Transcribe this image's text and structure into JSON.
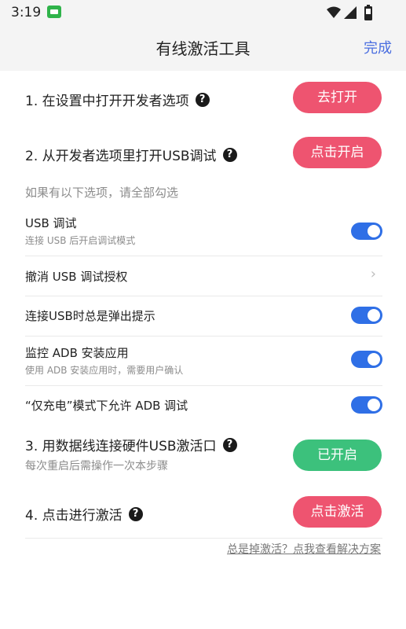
{
  "status_bar": {
    "time": "3:19"
  },
  "header": {
    "title": "有线激活工具",
    "done_label": "完成"
  },
  "steps": [
    {
      "label": "1. 在设置中打开开发者选项",
      "button": "去打开"
    },
    {
      "label": "2. 从开发者选项里打开USB调试",
      "button": "点击开启"
    },
    {
      "label": "3. 用数据线连接硬件USB激活口",
      "subtitle": "每次重启后需操作一次本步骤",
      "button": "已开启"
    },
    {
      "label": "4. 点击进行激活",
      "button": "点击激活"
    }
  ],
  "hint": "如果有以下选项，请全部勾选",
  "options": [
    {
      "label": "USB 调试",
      "desc": "连接 USB 后开启调试模式",
      "type": "toggle",
      "on": true
    },
    {
      "label": "撤消 USB 调试授权",
      "type": "chevron"
    },
    {
      "label": "连接USB时总是弹出提示",
      "type": "toggle",
      "on": true
    },
    {
      "label": "监控 ADB 安装应用",
      "desc": "使用 ADB 安装应用时，需要用户确认",
      "type": "toggle",
      "on": true
    },
    {
      "label": "“仅充电”模式下允许 ADB 调试",
      "type": "toggle",
      "on": true
    }
  ],
  "help_glyph": "?",
  "chevron_glyph": "›",
  "footer_link": "总是掉激活？点我查看解决方案",
  "colors": {
    "red_button": "#ee5470",
    "green_button": "#3cc17c",
    "toggle_on": "#2f6fe6",
    "link": "#4a6ee0"
  }
}
